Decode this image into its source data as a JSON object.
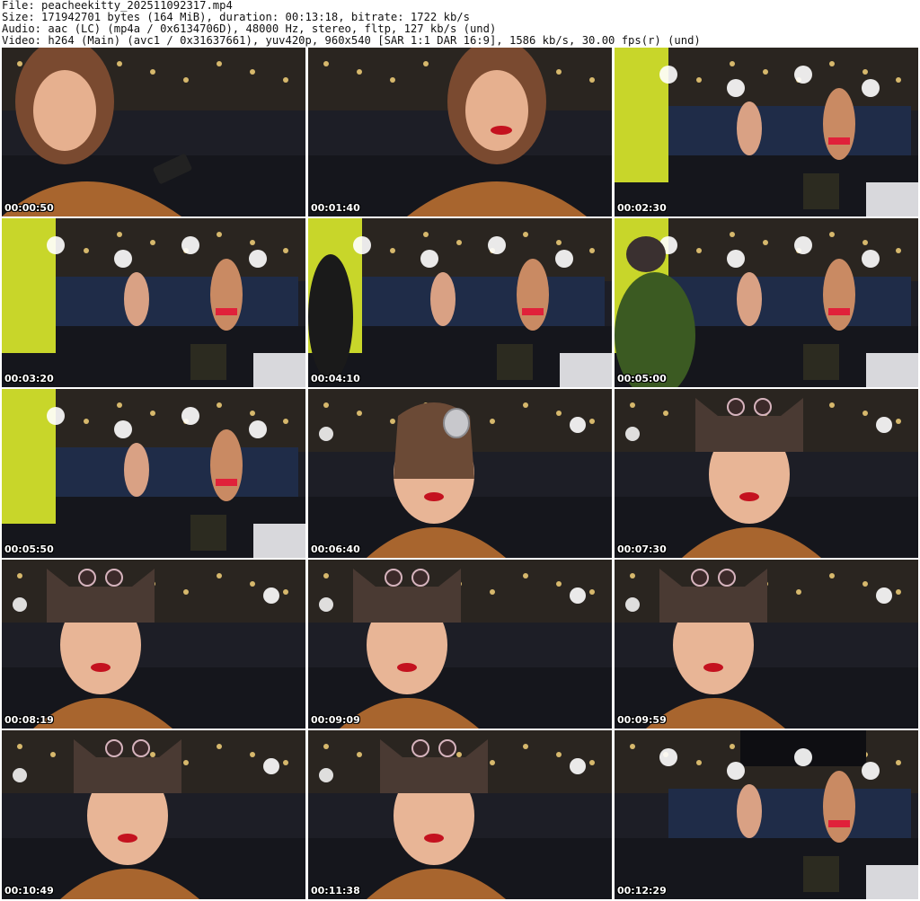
{
  "header": {
    "file_line": "File: peacheekitty_202511092317.mp4",
    "size_line": "Size: 171942701 bytes (164 MiB), duration: 00:13:18, bitrate: 1722 kb/s",
    "audio_line": "Audio: aac (LC) (mp4a / 0x6134706D), 48000 Hz, stereo, fltp, 127 kb/s (und)",
    "video_line": "Video: h264 (Main) (avc1 / 0x31637661), yuv420p, 960x540 [SAR 1:1 DAR 16:9], 1586 kb/s, 30.00 fps(r) (und)"
  },
  "thumbnails": [
    {
      "timestamp": "00:00:50",
      "scene": "closeup-phone"
    },
    {
      "timestamp": "00:01:40",
      "scene": "closeup-smile"
    },
    {
      "timestamp": "00:02:30",
      "scene": "wide-booth"
    },
    {
      "timestamp": "00:03:20",
      "scene": "wide-booth"
    },
    {
      "timestamp": "00:04:10",
      "scene": "wide-booth-person"
    },
    {
      "timestamp": "00:05:00",
      "scene": "wide-booth-green"
    },
    {
      "timestamp": "00:05:50",
      "scene": "wide-booth"
    },
    {
      "timestamp": "00:06:40",
      "scene": "drinking"
    },
    {
      "timestamp": "00:07:30",
      "scene": "hat-hand"
    },
    {
      "timestamp": "00:08:19",
      "scene": "hat-face"
    },
    {
      "timestamp": "00:09:09",
      "scene": "hat-face"
    },
    {
      "timestamp": "00:09:59",
      "scene": "hat-face"
    },
    {
      "timestamp": "00:10:49",
      "scene": "hat-closeup"
    },
    {
      "timestamp": "00:11:38",
      "scene": "hat-drinking"
    },
    {
      "timestamp": "00:12:29",
      "scene": "wide-distillery"
    }
  ]
}
